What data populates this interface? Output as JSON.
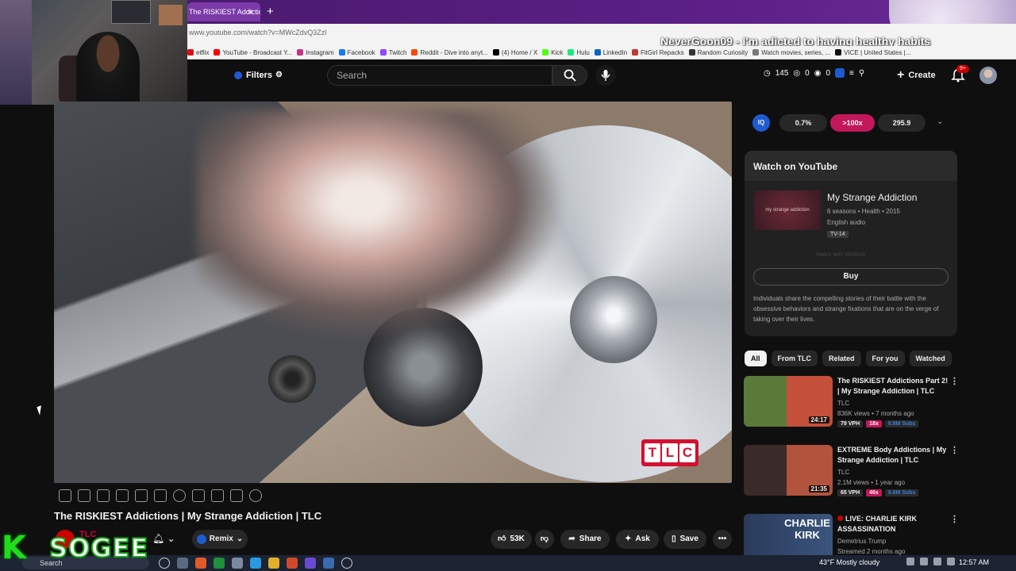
{
  "browser": {
    "tab_title": "The RISKIEST Addictio",
    "tab_close": "×",
    "new_tab": "+",
    "url": "www.youtube.com/watch?v=MWcZdvQ3Zzl",
    "bookmarks": [
      "etflix",
      "YouTube - Broadcast Y...",
      "Instagram",
      "Facebook",
      "Twitch",
      "Reddit - Dive into anyt...",
      "(4) Home / X",
      "Kick",
      "Hulu",
      "LinkedIn",
      "FitGirl Repacks",
      "Random Curiosity",
      "Watch movies, series, ...",
      "VICE | United States |..."
    ]
  },
  "stream_overlay": {
    "chat_message": "NeverGoon09 - I'm adicted to having healthy habits",
    "logo_k": "K",
    "logo_text": "SOGEE"
  },
  "header": {
    "filters_label": "Filters",
    "search_placeholder": "Search",
    "stat_1": "145",
    "stat_2": "0",
    "stat_3": "0",
    "create_label": "Create",
    "notif_badge": "9+"
  },
  "video": {
    "title": "The RISKIEST Addictions | My Strange Addiction | TLC",
    "watermark": [
      "T",
      "L",
      "C"
    ],
    "channel_name": "TLC",
    "remix_label": "Remix",
    "likes": "53K",
    "share_label": "Share",
    "ask_label": "Ask",
    "save_label": "Save",
    "more": "•••"
  },
  "iq_bar": {
    "logo": "IQ",
    "value_1": "0.7%",
    "value_2": ">100x",
    "value_3": "295.9",
    "chevron": "⌄"
  },
  "watch_card": {
    "heading": "Watch on YouTube",
    "show_title": "My Strange Addiction",
    "thumb_text": "my strange addiction",
    "meta": "6 seasons • Health • 2015",
    "audio": "English audio",
    "rating": "TV-14",
    "faint": "Watch with Whitlock",
    "buy_label": "Buy",
    "description": "Individuals share the compelling stories of their battle with the obsessive behaviors and strange fixations that are on the verge of taking over their lives."
  },
  "chips": [
    "All",
    "From TLC",
    "Related",
    "For you",
    "Watched"
  ],
  "recommendations": [
    {
      "title": "The RISKIEST Addictions Part 2! | My Strange Addiction | TLC",
      "channel": "TLC",
      "meta": "836K views • 7 months ago",
      "duration": "24:17",
      "vph": "79 VPH",
      "mult": "18x",
      "subs": "8.8M Subs",
      "thumb_color": "#c44f3a"
    },
    {
      "title": "EXTREME Body Addictions | My Strange Addiction | TLC",
      "channel": "TLC",
      "meta": "2.1M views • 1 year ago",
      "duration": "21:35",
      "vph": "65 VPH",
      "mult": "46x",
      "subs": "8.8M Subs",
      "thumb_color": "#b2533e"
    },
    {
      "title": "LIVE: CHARLIE KIRK ASSASSINATION",
      "channel": "Demetrius Trump",
      "meta": "Streamed 2 months ago",
      "thumb_text": "CHARLIE KIRK",
      "thumb_color": "#2a3a5a"
    }
  ],
  "taskbar": {
    "search_label": "Search",
    "weather": "43°F  Mostly cloudy",
    "clock": "12:57 AM"
  },
  "colors": {
    "accent_red": "#cc0000",
    "tlc_red": "#d3102f",
    "iq_blue": "#1e5bd1",
    "iq_pink": "#c2185b",
    "subs_blue": "#3a7bd5"
  }
}
